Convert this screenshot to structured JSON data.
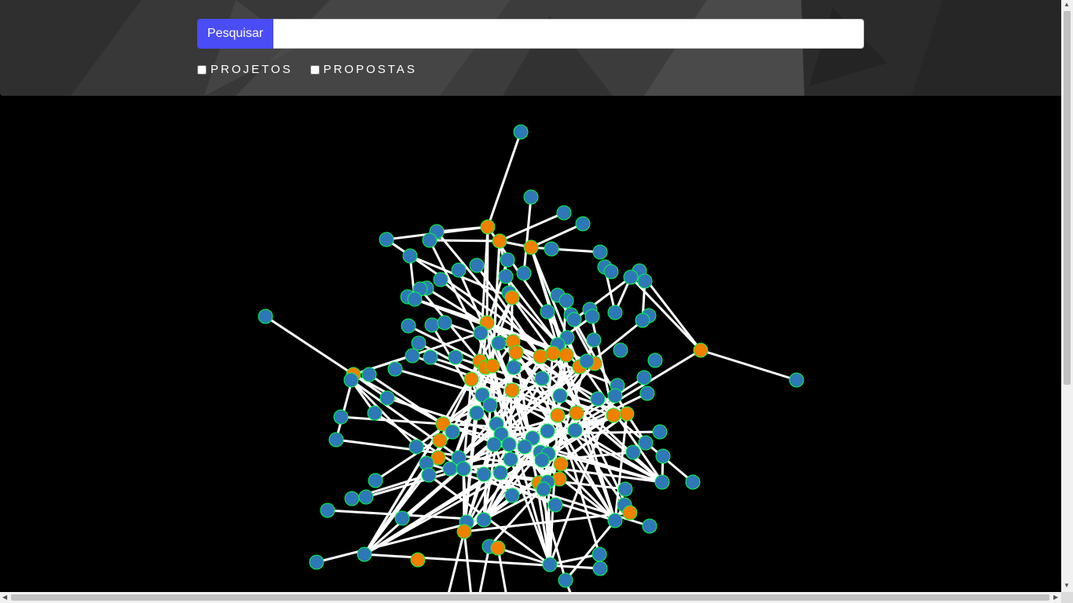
{
  "search": {
    "button_label": "Pesquisar",
    "input_value": "",
    "placeholder": ""
  },
  "filters": [
    {
      "label": "PROJETOS",
      "checked": false
    },
    {
      "label": "PROPOSTAS",
      "checked": false
    }
  ],
  "colors": {
    "search_button": "#4a4cf5",
    "projeto_node": "#2e78b7",
    "proposta_node": "#f08000",
    "node_stroke": "#00ff40",
    "edge": "#ffffff",
    "canvas_bg": "#000000"
  },
  "icons": {
    "scroll_up": "triangle-up",
    "scroll_down": "triangle-down",
    "scroll_left": "triangle-left",
    "scroll_right": "triangle-right"
  }
}
